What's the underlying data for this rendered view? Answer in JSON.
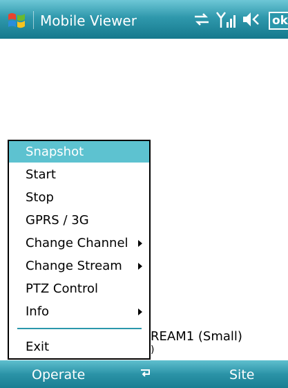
{
  "title_bar": {
    "app_title": "Mobile Viewer",
    "ok_label": "ok",
    "icons": [
      "start-menu-icon",
      "connectivity-icon",
      "signal-strength-icon",
      "volume-icon"
    ]
  },
  "content": {
    "stream_label": "REAM1 (Small)",
    "stream_label_cut": ")"
  },
  "menu": {
    "items": [
      {
        "label": "Snapshot",
        "selected": true
      },
      {
        "label": "Start"
      },
      {
        "label": "Stop"
      },
      {
        "label": "GPRS / 3G"
      },
      {
        "label": "Change Channel",
        "submenu": true
      },
      {
        "label": "Change Stream",
        "submenu": true
      },
      {
        "label": "PTZ Control"
      },
      {
        "label": "Info",
        "submenu": true
      },
      {
        "label": "Exit"
      }
    ]
  },
  "softkeys": {
    "left": "Operate",
    "right": "Site",
    "center_icon": "input-panel-icon"
  },
  "colors": {
    "title_bar": "#2f98ac",
    "menu_highlight": "#5dc2d0",
    "menu_separator": "#2a97ab",
    "softkey_bar": "#2b93a7"
  }
}
